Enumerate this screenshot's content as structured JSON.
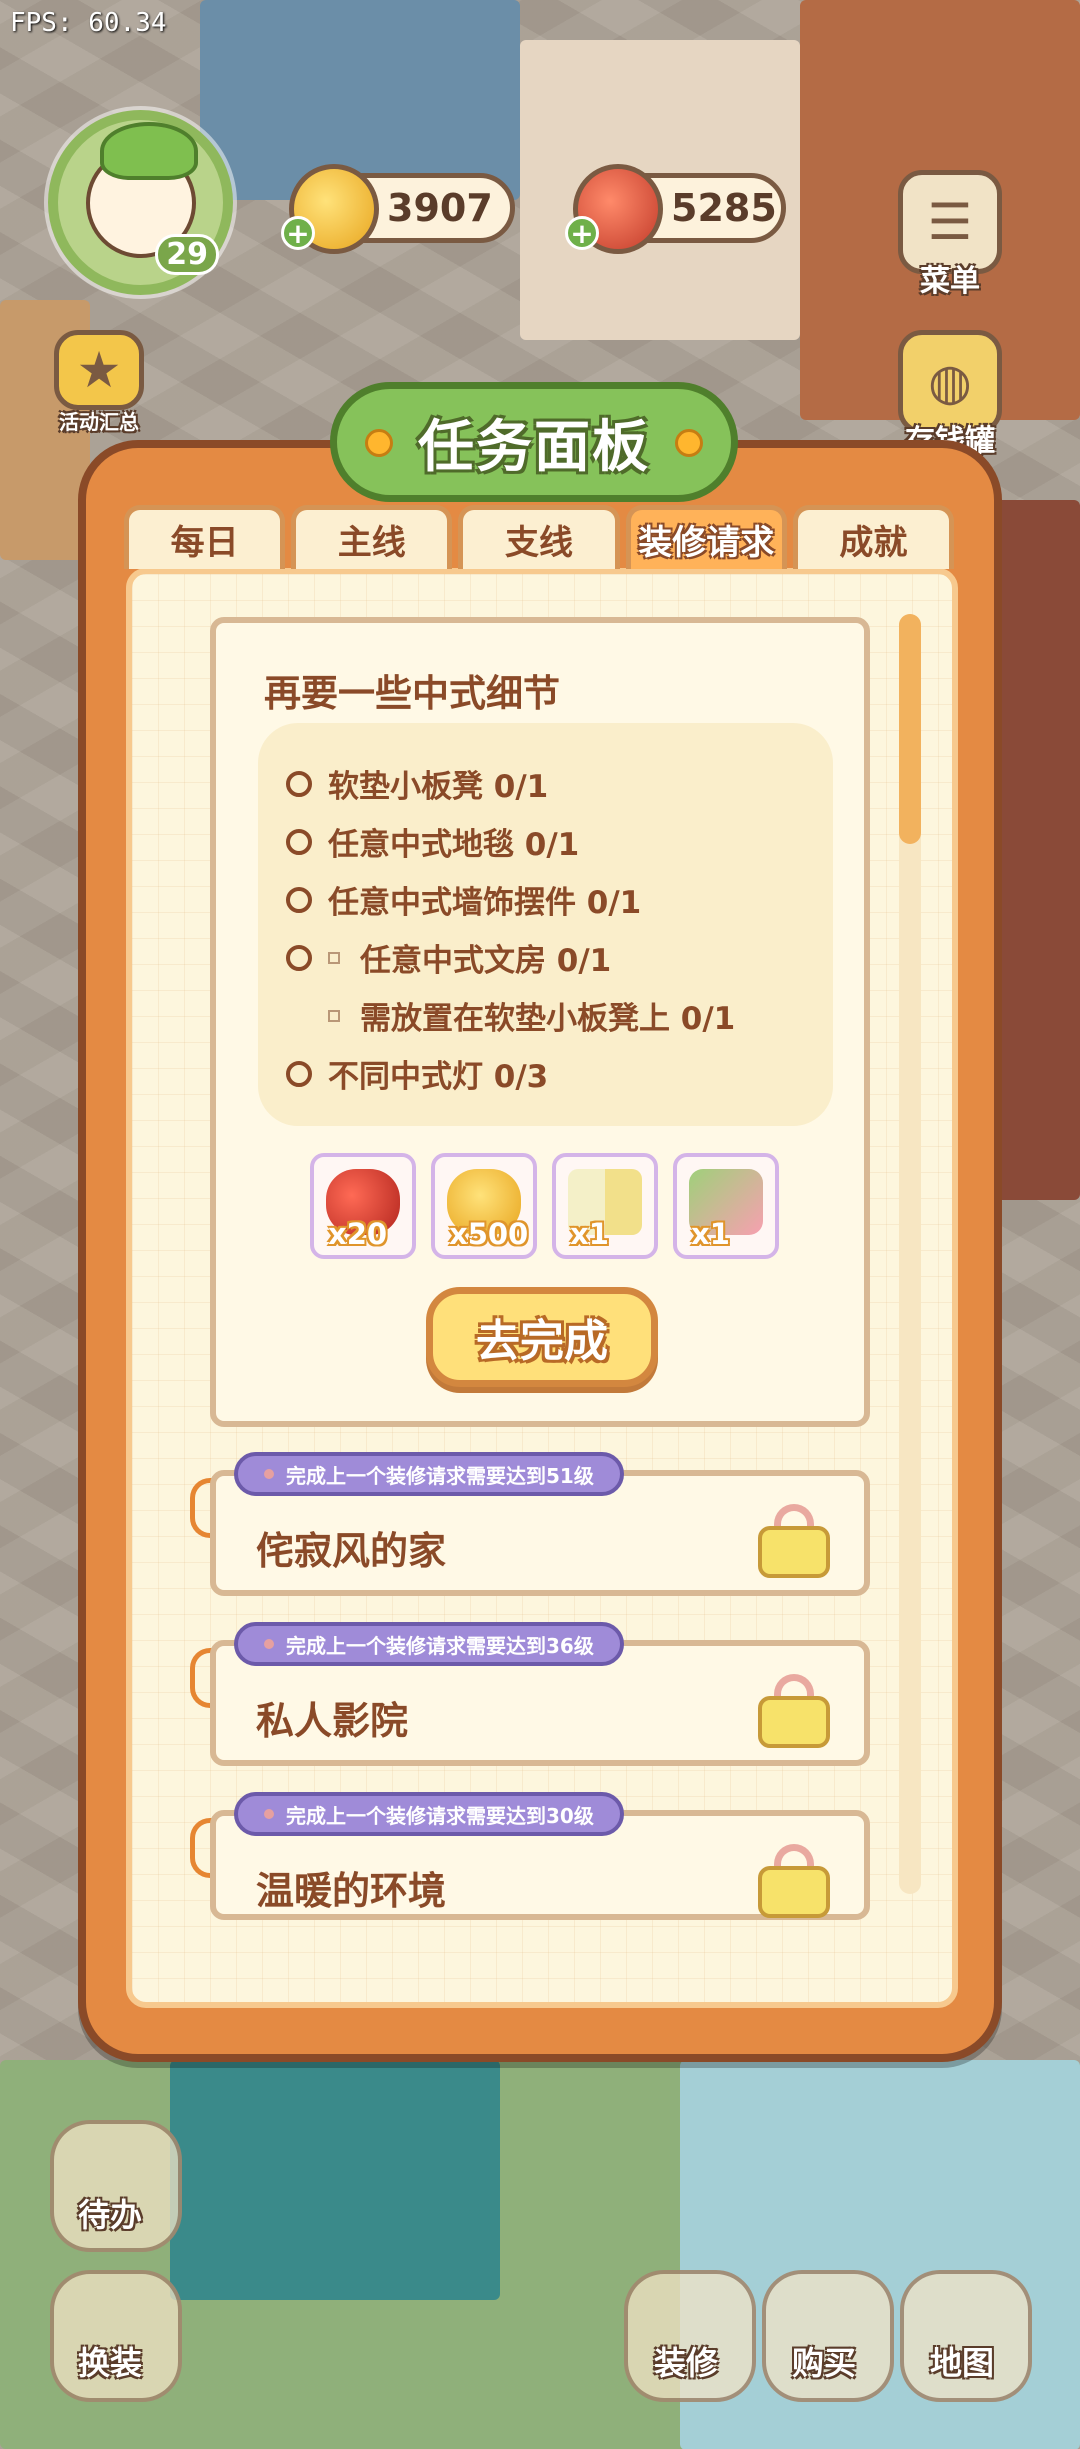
{
  "fps": "FPS: 60.34",
  "hud": {
    "level": "29",
    "coins": "3907",
    "apples": "5285",
    "menu_label": "菜单",
    "piggy_label": "存钱罐",
    "events_label": "活动汇总",
    "todo_label": "待办",
    "dress_label": "换装",
    "decorate_label": "装修",
    "buy_label": "购买",
    "map_label": "地图"
  },
  "panel": {
    "title": "任务面板",
    "tabs": [
      {
        "label": "每日"
      },
      {
        "label": "主线"
      },
      {
        "label": "支线"
      },
      {
        "label": "装修请求"
      },
      {
        "label": "成就"
      }
    ],
    "active_tab": "装修请求"
  },
  "current_request": {
    "title": "再要一些中式细节",
    "requirements": [
      {
        "text": "软垫小板凳 0/1"
      },
      {
        "text": "任意中式地毯 0/1"
      },
      {
        "text": "任意中式墙饰摆件 0/1"
      },
      {
        "text": "任意中式文房 0/1"
      },
      {
        "text": "需放置在软垫小板凳上 0/1"
      },
      {
        "text": "不同中式灯 0/3"
      }
    ],
    "rewards": [
      {
        "icon": "cherry-icon",
        "amount": "x20"
      },
      {
        "icon": "gold-pile-icon",
        "amount": "x500"
      },
      {
        "icon": "sprout-block-icon",
        "amount": "x1"
      },
      {
        "icon": "decoration-box-icon",
        "amount": "x1"
      }
    ],
    "go_button": "去完成"
  },
  "locked_requests": [
    {
      "requirement": "完成上一个装修请求需要达到51级",
      "name": "侘寂风的家"
    },
    {
      "requirement": "完成上一个装修请求需要达到36级",
      "name": "私人影院"
    },
    {
      "requirement": "完成上一个装修请求需要达到30级",
      "name": "温暖的环境"
    }
  ]
}
